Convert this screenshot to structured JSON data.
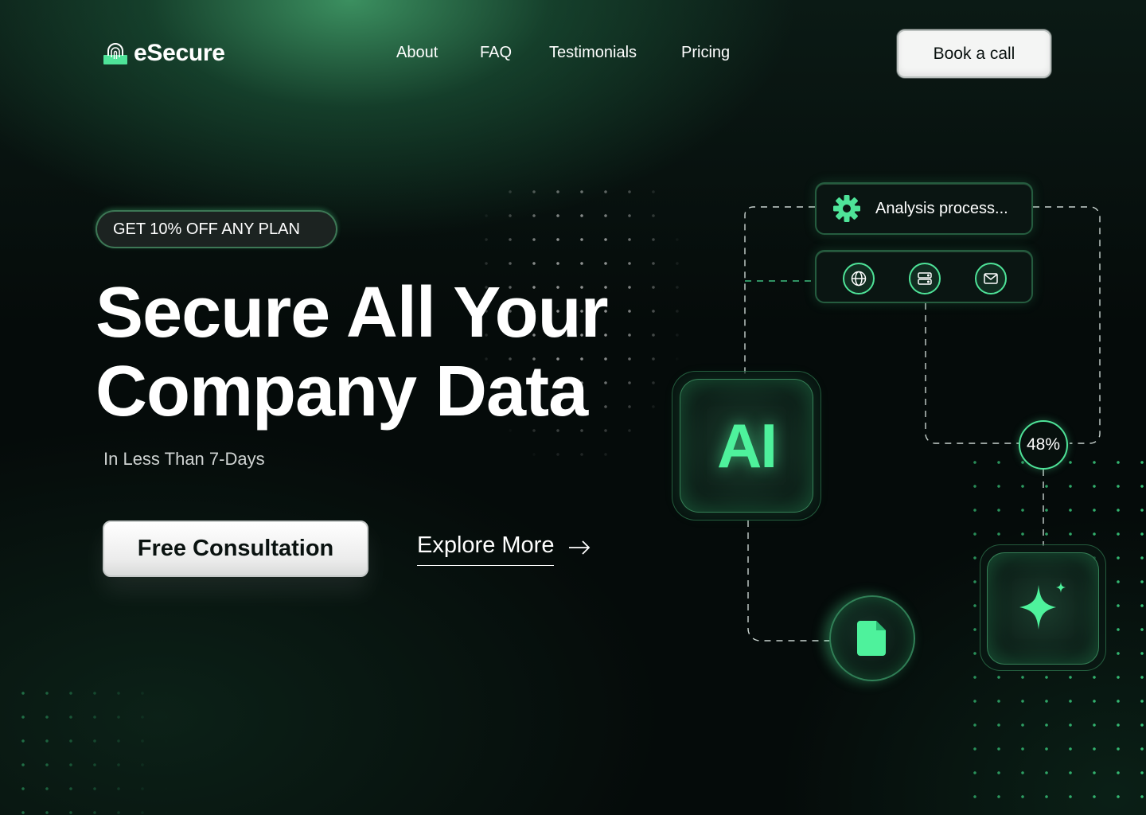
{
  "brand": {
    "name": "eSecure",
    "logo_icon": "fingerprint-lock-icon"
  },
  "nav": {
    "items": [
      {
        "label": "About"
      },
      {
        "label": "FAQ"
      },
      {
        "label": "Testimonials"
      },
      {
        "label": "Pricing"
      }
    ],
    "cta_label": "Book a call"
  },
  "hero": {
    "promo_label": "GET 10% OFF ANY PLAN",
    "headline_line1": "Secure All Your",
    "headline_line2": "Company Data",
    "subheadline": "In Less Than 7-Days",
    "primary_cta": "Free Consultation",
    "secondary_cta": "Explore More",
    "secondary_cta_icon": "arrow-right-icon"
  },
  "illustration": {
    "status_text": "Analysis process...",
    "status_icon": "gear-icon",
    "service_icons": [
      "globe-icon",
      "server-icon",
      "mail-icon"
    ],
    "ai_label": "AI",
    "progress_label": "48%",
    "progress_value": 48,
    "document_icon": "document-icon",
    "sparkle_icon": "sparkle-icon"
  },
  "colors": {
    "accent": "#4ee398",
    "accent_bright": "#4ef29c",
    "background": "#050b0a",
    "button_light": "#f4f5f4"
  }
}
